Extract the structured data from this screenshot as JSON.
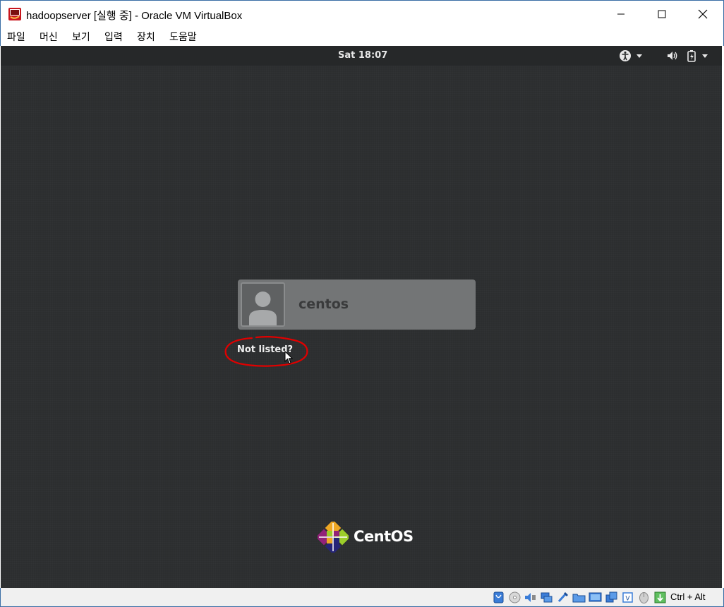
{
  "window": {
    "title": "hadoopserver [실행 중] - Oracle VM VirtualBox",
    "minimize_icon": "minimize-icon",
    "maximize_icon": "maximize-icon",
    "close_icon": "close-icon"
  },
  "menu": {
    "items": [
      "파일",
      "머신",
      "보기",
      "입력",
      "장치",
      "도움말"
    ]
  },
  "vm": {
    "top_panel": {
      "clock": "Sat 18:07",
      "icons": [
        "accessibility-icon",
        "dropdown-arrow-icon",
        "volume-icon",
        "battery-icon",
        "dropdown-arrow-icon"
      ]
    },
    "login": {
      "user_name": "centos",
      "avatar_icon": "user-avatar-icon",
      "not_listed": "Not listed?"
    },
    "brand": {
      "logo_icon": "centos-logo-icon",
      "name": "CentOS"
    },
    "colors": {
      "background": "#2c2e2f",
      "annotation": "#e00000"
    }
  },
  "statusbar": {
    "icons": [
      "hard-disk-icon",
      "optical-drive-icon",
      "audio-icon",
      "network-icon",
      "usb-icon",
      "shared-folders-icon",
      "display-icon",
      "video-capture-icon",
      "cpu-icon",
      "mouse-integration-icon",
      "keyboard-capture-icon"
    ],
    "host_key": "Ctrl + Alt"
  }
}
